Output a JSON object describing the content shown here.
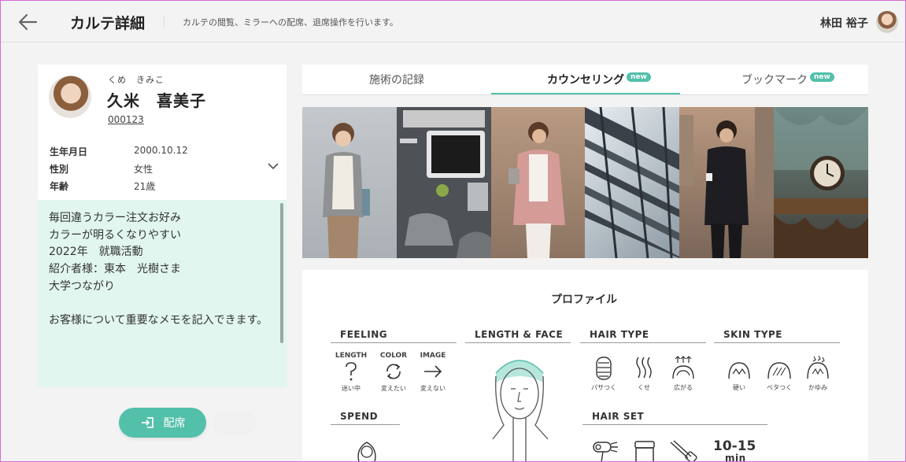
{
  "header": {
    "title": "カルテ詳細",
    "subtitle": "カルテの閲覧、ミラーへの配席、退席操作を行います。",
    "user_name": "林田 裕子"
  },
  "customer": {
    "kana": "くめ　きみこ",
    "name": "久米　喜美子",
    "id": "000123",
    "rows": [
      {
        "label": "生年月日",
        "value": "2000.10.12"
      },
      {
        "label": "性別",
        "value": "女性"
      },
      {
        "label": "年齢",
        "value": "21歳"
      }
    ]
  },
  "memo": {
    "lines": [
      "毎回違うカラー注文お好み",
      "カラーが明るくなりやすい",
      "2022年　就職活動",
      "紹介者様：東本　光樹さま",
      "大学つながり",
      "",
      "お客様について重要なメモを記入できます。"
    ]
  },
  "actions": {
    "seat_label": "配席"
  },
  "tabs": [
    {
      "label": "施術の記録",
      "badge": ""
    },
    {
      "label": "カウンセリング",
      "badge": "new"
    },
    {
      "label": "ブックマーク",
      "badge": "new"
    }
  ],
  "profile": {
    "title": "プロファイル",
    "feeling": {
      "heading": "FEELING",
      "items": [
        {
          "label": "LENGTH",
          "icon": "question-icon",
          "caption": "迷い中"
        },
        {
          "label": "COLOR",
          "icon": "cycle-icon",
          "caption": "変えたい"
        },
        {
          "label": "IMAGE",
          "icon": "arrow-right-icon",
          "caption": "変えない"
        }
      ]
    },
    "length_face": {
      "heading": "LENGTH & FACE"
    },
    "hair_type": {
      "heading": "HAIR TYPE",
      "items": [
        {
          "icon": "dry-hair-icon",
          "caption": "パサつく"
        },
        {
          "icon": "wavy-hair-icon",
          "caption": "くせ"
        },
        {
          "icon": "spread-hair-icon",
          "caption": "広がる"
        }
      ]
    },
    "skin_type": {
      "heading": "SKIN TYPE",
      "items": [
        {
          "icon": "dry-skin-icon",
          "caption": "硬い"
        },
        {
          "icon": "oily-skin-icon",
          "caption": "ベタつく"
        },
        {
          "icon": "itchy-skin-icon",
          "caption": "かゆみ"
        }
      ]
    },
    "spend": {
      "heading": "SPEND"
    },
    "hair_set": {
      "heading": "HAIR SET",
      "time_value": "10-15",
      "time_unit": "min"
    }
  },
  "colors": {
    "accent": "#53c0aa",
    "memo_bg": "#e1f6ef"
  }
}
